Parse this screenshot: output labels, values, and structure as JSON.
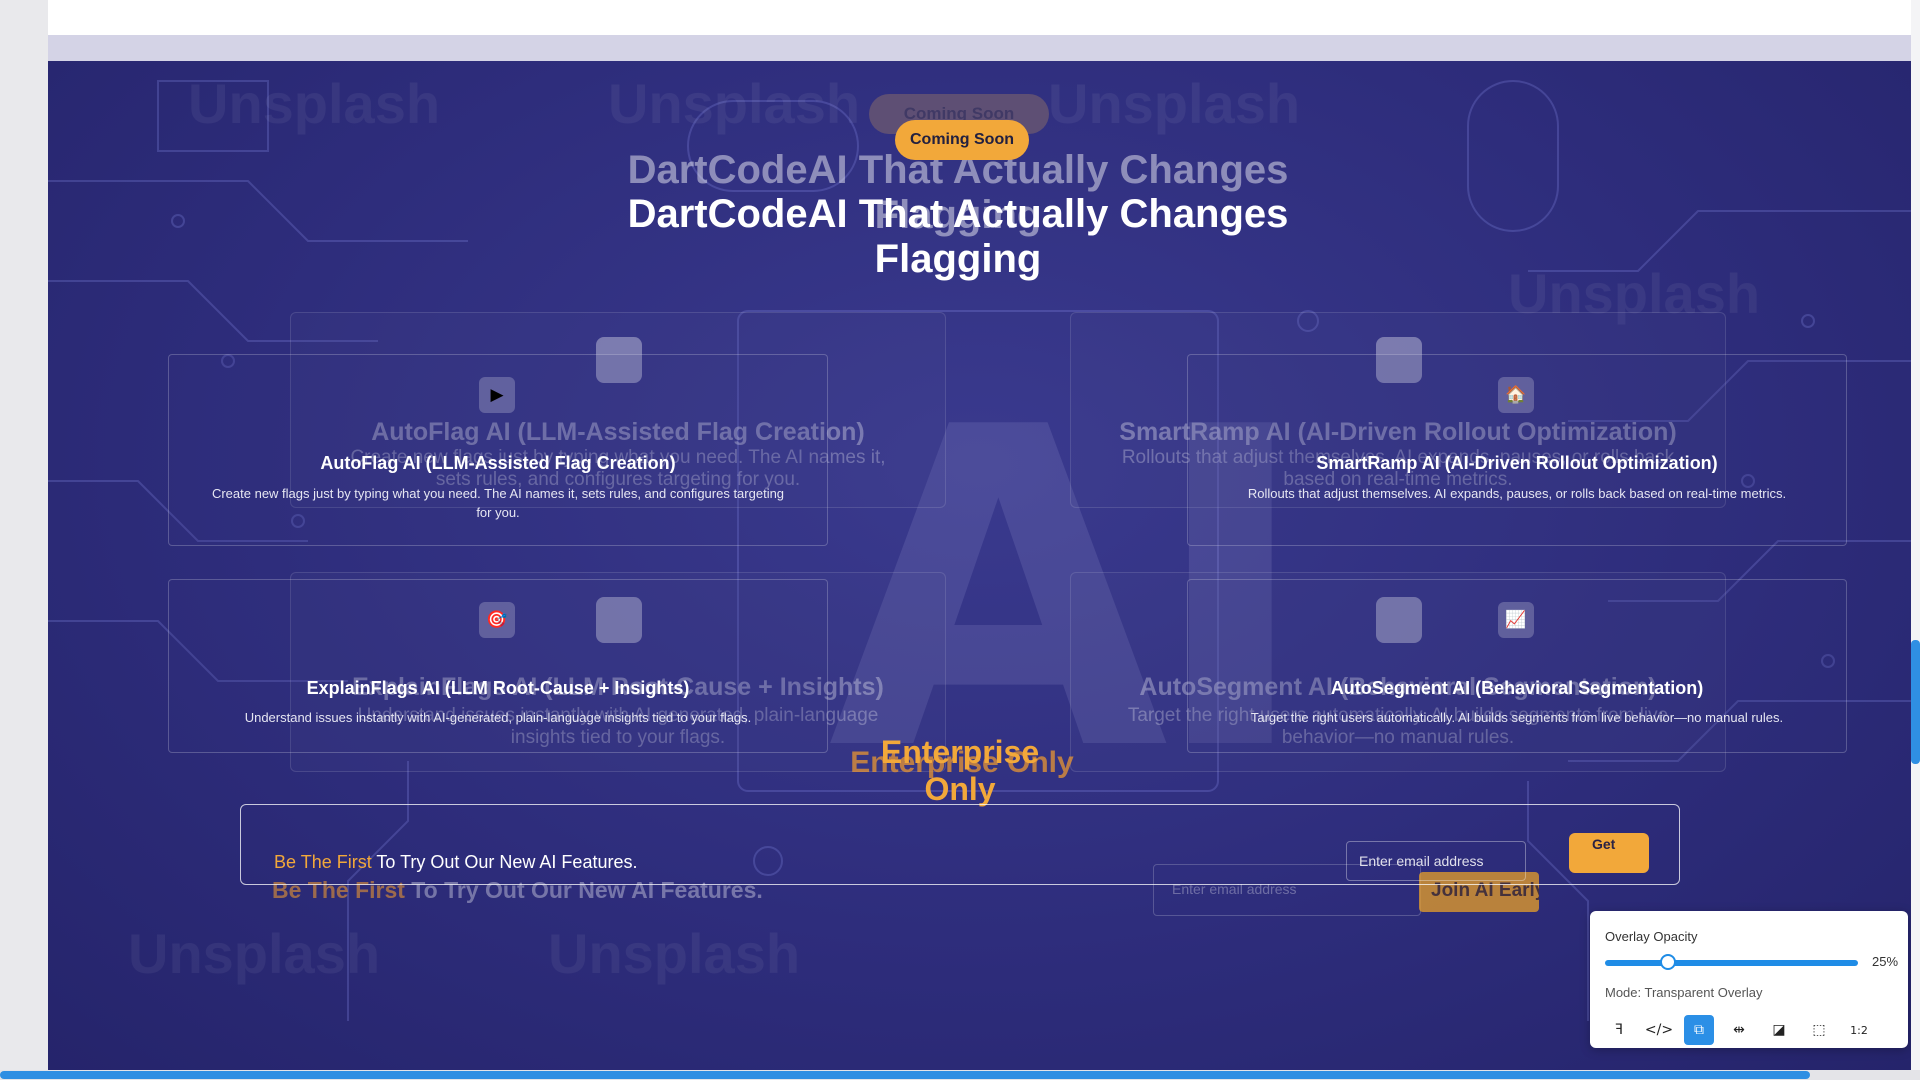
{
  "hero": {
    "badge": "Coming Soon",
    "title": "DartCodeAI That Actually Changes Flagging",
    "background_letters": "AI"
  },
  "cards": [
    {
      "icon": "play-icon",
      "glyph": "▶",
      "title": "AutoFlag AI (LLM-Assisted Flag Creation)",
      "description": "Create new flags just by typing what you need. The AI names it, sets rules, and configures targeting for you."
    },
    {
      "icon": "house-icon",
      "glyph": "🏠",
      "title": "SmartRamp AI (AI-Driven Rollout Optimization)",
      "description": "Rollouts that adjust themselves. AI expands, pauses, or rolls back based on real-time metrics."
    },
    {
      "icon": "target-icon",
      "glyph": "🎯",
      "title": "ExplainFlags AI (LLM Root-Cause + Insights)",
      "description": "Understand issues instantly with AI-generated, plain-language insights tied to your flags."
    },
    {
      "icon": "chart-icon",
      "glyph": "📈",
      "title": "AutoSegment AI (Behavioral Segmentation)",
      "description": "Target the right users automatically. AI builds segments from live behavior—no manual rules."
    }
  ],
  "ghost": {
    "badge": "Coming Soon",
    "title": "DartCodeAI That Actually Changes Flagging",
    "cards": [
      {
        "title": "AutoFlag AI (LLM-Assisted Flag Creation)",
        "description": "Create new flags just by typing what you need. The AI names it, sets rules, and configures targeting for you."
      },
      {
        "title": "SmartRamp AI (AI-Driven Rollout Optimization)",
        "description": "Rollouts that adjust themselves. AI expands, pauses, or rolls back based on real-time metrics."
      },
      {
        "title": "ExplainFlags AI (LLM Root-Cause + Insights)",
        "description": "Understand issues instantly with AI-generated, plain-language insights tied to your flags."
      },
      {
        "title": "AutoSegment AI (Behavioral Segmentation)",
        "description": "Target the right users automatically. AI builds segments from live behavior—no manual rules."
      }
    ],
    "enterprise": "Enterprise Only",
    "cta_accent": "Be The First",
    "cta_rest": " To Try Out Our New AI Features.",
    "email_placeholder": "Enter email address",
    "join_label": "Join AI Early Access"
  },
  "enterprise": {
    "label": "Enterprise Only"
  },
  "cta": {
    "accent": "Be The First",
    "rest": " To Try Out Our New AI Features.",
    "email_placeholder": "Enter email address",
    "button_label": "Get"
  },
  "overlay_panel": {
    "opacity_label": "Overlay Opacity",
    "opacity_value": "25%",
    "opacity_fraction": 0.25,
    "mode_label": "Mode: Transparent Overlay",
    "tools": [
      {
        "name": "figma-icon",
        "glyph": "ꟻ"
      },
      {
        "name": "code-icon",
        "glyph": "</>"
      },
      {
        "name": "overlay-icon",
        "glyph": "⧉",
        "active": true
      },
      {
        "name": "split-icon",
        "glyph": "⇹"
      },
      {
        "name": "contrast-icon",
        "glyph": "◪"
      },
      {
        "name": "select-area-icon",
        "glyph": "⬚"
      },
      {
        "name": "ratio-icon",
        "glyph": "1:2"
      }
    ]
  },
  "colors": {
    "background": "#2e2d7c",
    "accent": "#f2a83a",
    "panel_accent": "#2b8fe6"
  }
}
